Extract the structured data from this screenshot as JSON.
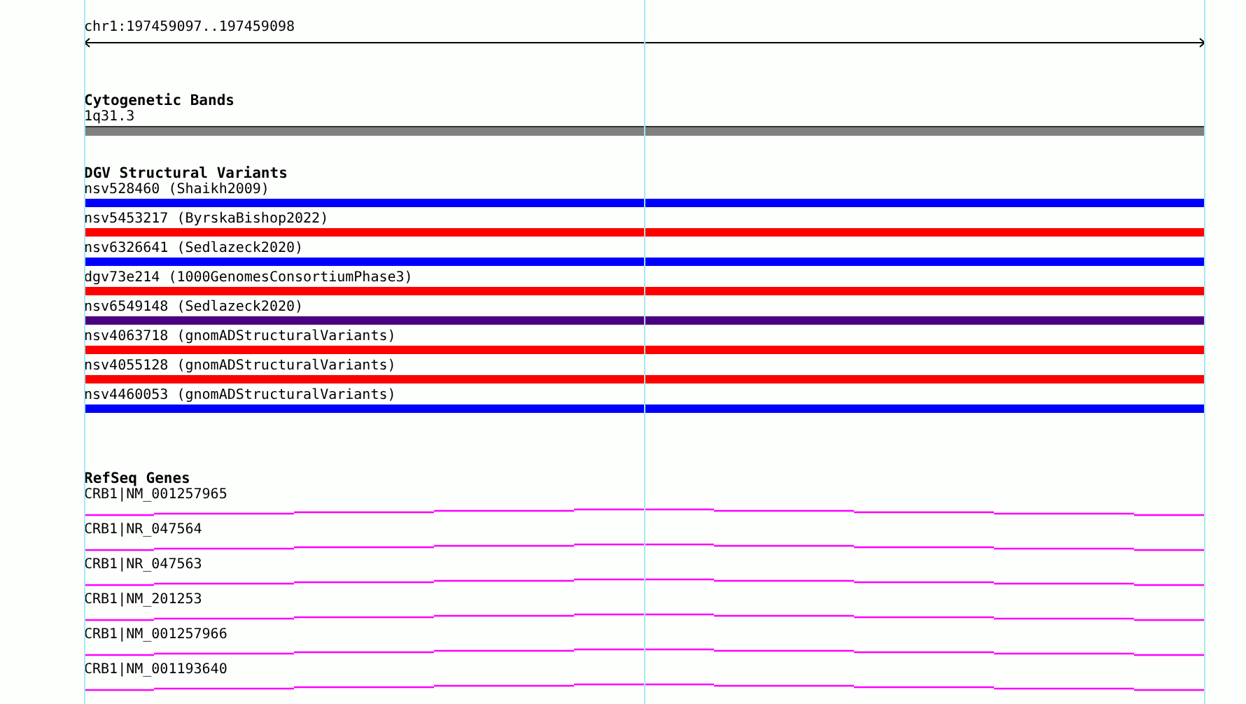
{
  "ruler": {
    "location": "chr1:197459097..197459098"
  },
  "cytogenetic_bands": {
    "title": "Cytogenetic Bands",
    "bands": [
      {
        "label": "1q31.3",
        "color": "#808080"
      }
    ]
  },
  "dgv_structural_variants": {
    "title": "DGV Structural Variants",
    "variants": [
      {
        "label": "nsv528460 (Shaikh2009)",
        "color": "#0000ff"
      },
      {
        "label": "nsv5453217 (ByrskaBishop2022)",
        "color": "#ff0000"
      },
      {
        "label": "nsv6326641 (Sedlazeck2020)",
        "color": "#0000ff"
      },
      {
        "label": "dgv73e214 (1000GenomesConsortiumPhase3)",
        "color": "#ff0000"
      },
      {
        "label": "nsv6549148 (Sedlazeck2020)",
        "color": "#4b0082"
      },
      {
        "label": "nsv4063718 (gnomADStructuralVariants)",
        "color": "#ff0000"
      },
      {
        "label": "nsv4055128 (gnomADStructuralVariants)",
        "color": "#ff0000"
      },
      {
        "label": "nsv4460053 (gnomADStructuralVariants)",
        "color": "#0000ff"
      }
    ]
  },
  "refseq_genes": {
    "title": "RefSeq Genes",
    "genes": [
      {
        "label": "CRB1|NM_001257965"
      },
      {
        "label": "CRB1|NR_047564"
      },
      {
        "label": "CRB1|NR_047563"
      },
      {
        "label": "CRB1|NM_201253"
      },
      {
        "label": "CRB1|NM_001257966"
      },
      {
        "label": "CRB1|NM_001193640"
      }
    ]
  }
}
